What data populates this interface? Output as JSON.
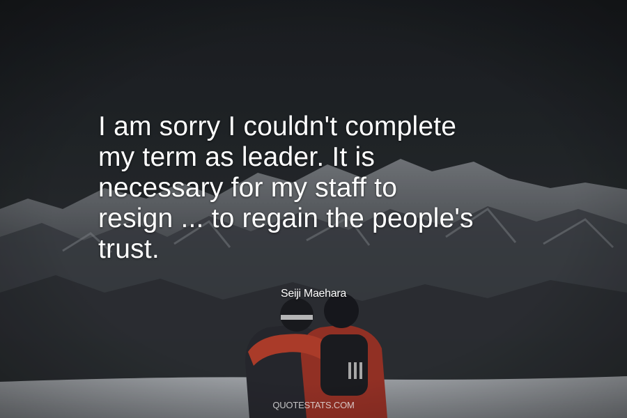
{
  "quote": {
    "lines": [
      "I am sorry I couldn't complete",
      "my term as leader. It is",
      "necessary for my staff to",
      "resign ... to regain the people's",
      "trust."
    ]
  },
  "author": "Seiji Maehara",
  "watermark": "QUOTESTATS.COM",
  "colors": {
    "sky": "#1f2328",
    "text": "#ffffff",
    "jacket": "#b33a2a",
    "snow": "#a7abb1"
  }
}
